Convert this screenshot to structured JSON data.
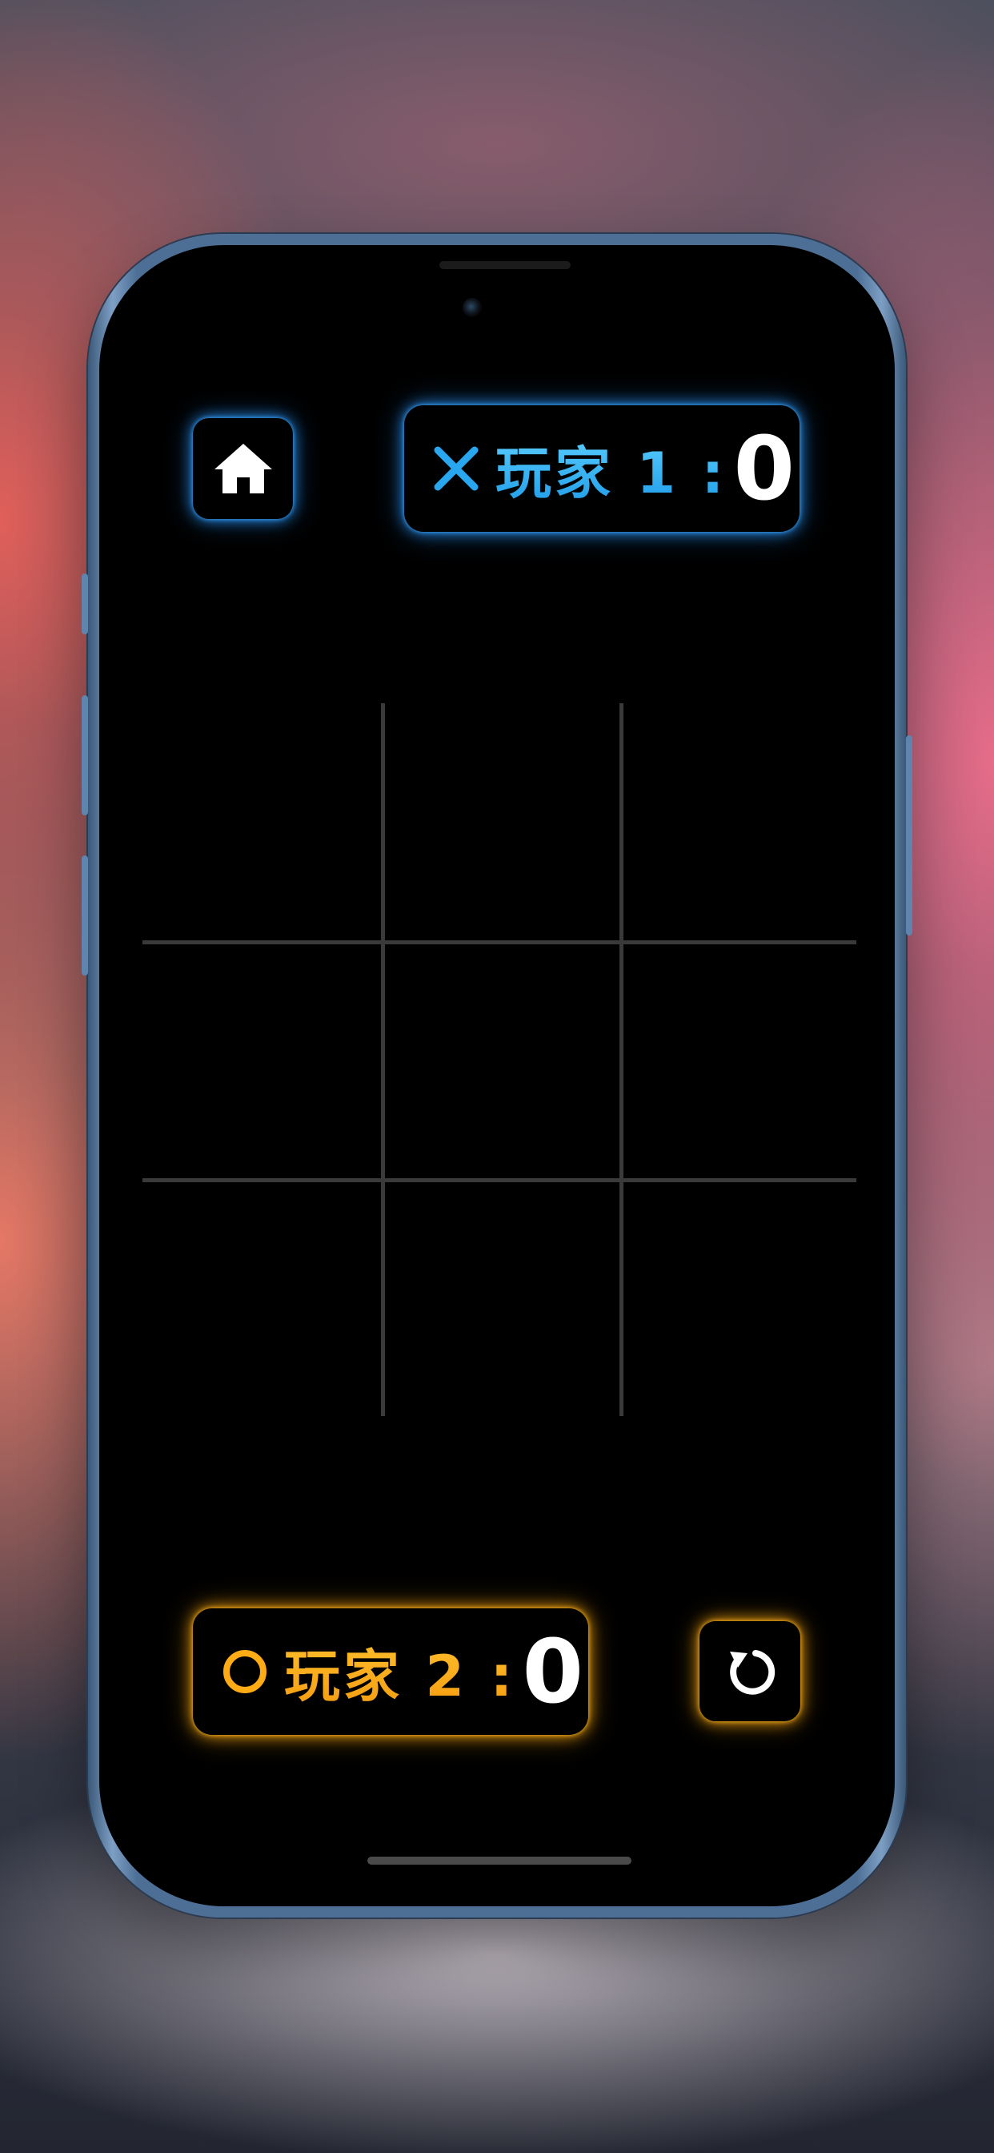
{
  "players": {
    "player1": {
      "label": "玩家 1 :",
      "score": "0",
      "symbol": "x-mark-icon",
      "color": "#29a6f0"
    },
    "player2": {
      "label": "玩家 2 :",
      "score": "0",
      "symbol": "o-ring-icon",
      "color": "#ffab16"
    }
  },
  "controls": {
    "home": {
      "icon": "house-icon"
    },
    "restart": {
      "icon": "restart-arrow-icon"
    }
  },
  "board": {
    "rows": 3,
    "cols": 3,
    "cells": [
      "",
      "",
      "",
      "",
      "",
      "",
      "",
      "",
      ""
    ]
  },
  "colors": {
    "background": "#000000",
    "grid_line": "#3a3a3a",
    "player1_glow": "#2a96ff",
    "player2_glow": "#ffaa14"
  }
}
